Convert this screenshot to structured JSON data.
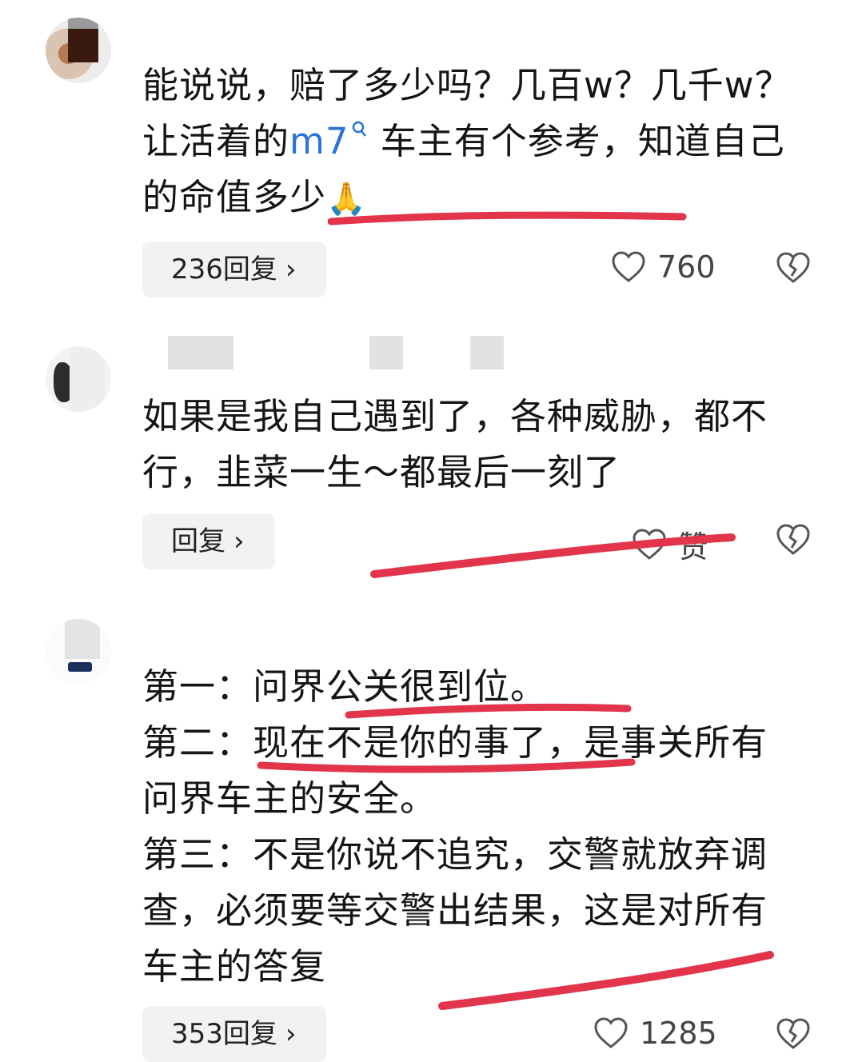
{
  "comments": [
    {
      "text_parts": [
        "能说说，赔了多少吗？几百w？几千w？让活着的",
        "m7",
        "车主有个参考，知道自己的命值多少"
      ],
      "emoji": "🙏",
      "reply_label": "236回复",
      "like_count": "760"
    },
    {
      "text": "如果是我自己遇到了，各种威胁，都不行，韭菜一生～都最后一刻了",
      "reply_label": "回复",
      "like_label": "赞"
    },
    {
      "lines": [
        "第一：问界公关很到位。",
        "第二：现在不是你的事了，是事关所有",
        "问界车主的安全。",
        "第三：不是你说不追究，交警就放弃调",
        "查，必须要等交警出结果，这是对所有",
        "车主的答复"
      ],
      "reply_label": "353回复",
      "like_count": "1285"
    }
  ],
  "icons": {
    "chevron": "chevron-right-icon",
    "like": "heart-outline-icon",
    "dislike": "broken-heart-icon",
    "search_mark": "search-icon"
  },
  "colors": {
    "link": "#2a73d9",
    "annotation": "#e2344a",
    "reply_bg": "#f2f2f2"
  }
}
